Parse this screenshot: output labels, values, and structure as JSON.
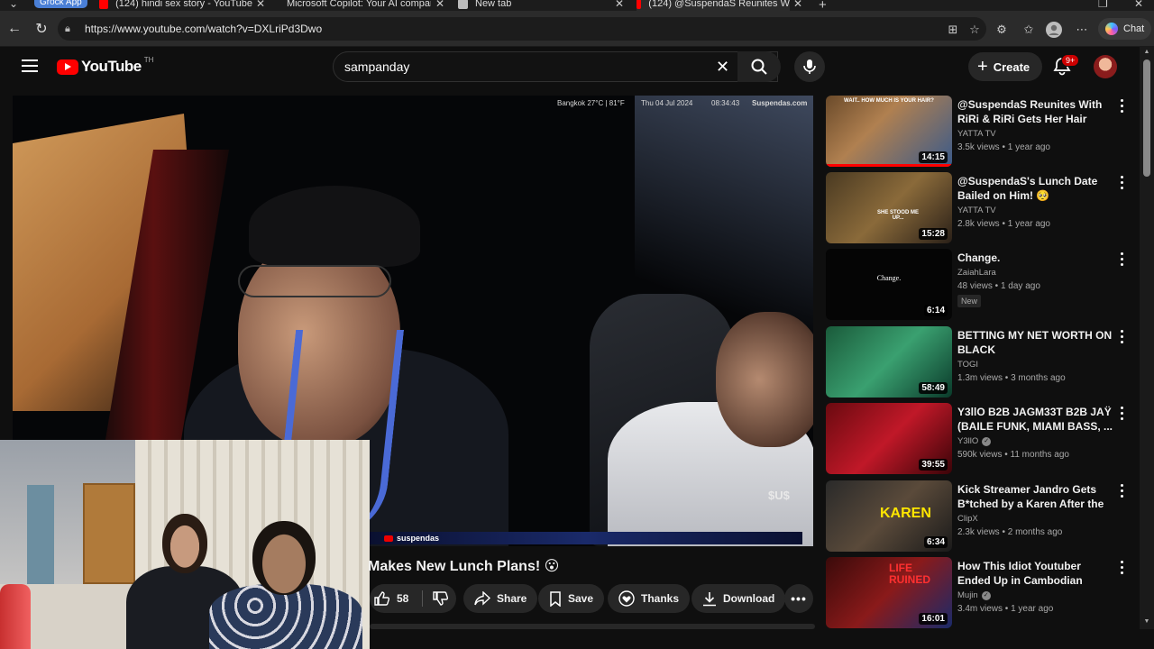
{
  "browser": {
    "tab_group": "Grock App",
    "tabs": [
      {
        "label": "(124) hindi sex story - YouTube",
        "fav_color": "#ff0000"
      },
      {
        "label": "Microsoft Copilot: Your AI compan",
        "fav_color": "#7b5cff"
      },
      {
        "label": "New tab",
        "fav_color": "#bbbbbb"
      },
      {
        "label": "(124) @SuspendaS Reunites W",
        "fav_color": "#ff0000"
      }
    ],
    "url": "https://www.youtube.com/watch?v=DXLriPd3Dwo",
    "chat_label": "Chat"
  },
  "youtube": {
    "logo_text": "YouTube",
    "region": "TH",
    "search_value": "sampanday",
    "create_label": "Create",
    "notifications": "9+"
  },
  "video": {
    "overlay_location": "Bangkok 27°C | 81°F",
    "overlay_date": "Thu 04 Jul 2024",
    "overlay_time": "08:34:43",
    "overlay_site": "Suspendas.com",
    "watermark": "$U$",
    "channel_tag": "suspendas",
    "title": "Makes New Lunch Plans! 😮",
    "likes": "58",
    "share_label": "Share",
    "save_label": "Save",
    "thanks_label": "Thanks",
    "download_label": "Download"
  },
  "colors": {
    "accent": "#ff0000",
    "background": "#0f0f0f",
    "pill": "#272727"
  },
  "sidebar": [
    {
      "title": "@SuspendaS Reunites With RiRi & RiRi Gets Her Hair Done For ...",
      "channel": "YATTA TV",
      "meta": "3.5k views • 1 year ago",
      "duration": "14:15",
      "verified": false,
      "new": "",
      "thumb_bg": "linear-gradient(135deg,#6a4a2a,#b08050 40%,#3a5a8a)",
      "watched": 1.0,
      "thumb_caption": "WAIT.. HOW MUCH IS YOUR HAIR?"
    },
    {
      "title": "@SuspendaS's Lunch Date Bailed on Him! 🥺",
      "channel": "YATTA TV",
      "meta": "2.8k views • 1 year ago",
      "duration": "15:28",
      "verified": false,
      "new": "",
      "thumb_bg": "linear-gradient(135deg,#4a3a22,#8a6a3a 50%,#2a2018)",
      "watched": 0,
      "thumb_caption": "SHE STOOD ME UP..."
    },
    {
      "title": "Change.",
      "channel": "ZaiahLara",
      "meta": "48 views • 1 day ago",
      "duration": "6:14",
      "verified": false,
      "new": "New",
      "thumb_bg": "#050505",
      "watched": 0,
      "thumb_caption": "Change."
    },
    {
      "title": "BETTING MY NET WORTH ON BLACK",
      "channel": "TOGI",
      "meta": "1.3m views • 3 months ago",
      "duration": "58:49",
      "verified": false,
      "new": "",
      "thumb_bg": "linear-gradient(135deg,#1a5a3a,#3aa070 50%,#0a3a2a)",
      "watched": 0,
      "thumb_caption": ""
    },
    {
      "title": "Y3llO B2B JAGM33T B2B JAŸ (BAILE FUNK, MIAMI BASS, ...",
      "channel": "Y3llO",
      "meta": "590k views • 11 months ago",
      "duration": "39:55",
      "verified": true,
      "new": "",
      "thumb_bg": "linear-gradient(135deg,#6a0a10,#c01828 50%,#3a0408)",
      "watched": 0,
      "thumb_caption": ""
    },
    {
      "title": "Kick Streamer Jandro Gets B*tched by a Karen After the ...",
      "channel": "ClipX",
      "meta": "2.3k views • 2 months ago",
      "duration": "6:34",
      "verified": false,
      "new": "",
      "thumb_bg": "linear-gradient(135deg,#2a2a2a,#5a4a3a 50%,#1a1a1a)",
      "watched": 0,
      "thumb_caption": "KAREN"
    },
    {
      "title": "How This Idiot Youtuber Ended Up in Cambodian Prison",
      "channel": "Mujin",
      "meta": "3.4m views • 1 year ago",
      "duration": "16:01",
      "verified": true,
      "new": "",
      "thumb_bg": "linear-gradient(135deg,#3a0a0a,#8a1a1a 50%,#1a2a6a)",
      "watched": 0,
      "thumb_caption": "LIFE RUINED"
    }
  ]
}
